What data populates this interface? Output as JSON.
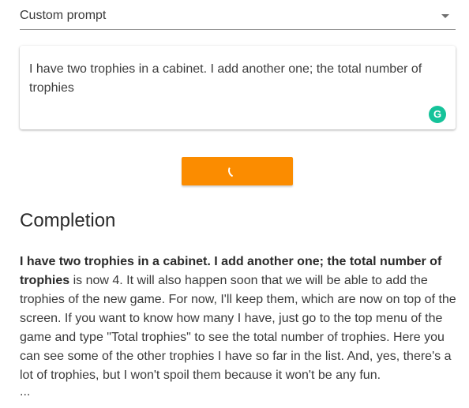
{
  "model_select": {
    "selected": "Custom prompt"
  },
  "prompt": {
    "text": "I have two trophies in a cabinet. I add another one; the total number of trophies"
  },
  "grammarly": {
    "glyph": "G",
    "icon": "grammarly-icon"
  },
  "submit_button": {
    "state": "loading",
    "icon": "spinner-icon",
    "color": "#fb8c00"
  },
  "completion": {
    "heading": "Completion",
    "prompt_bold": "I have two trophies in a cabinet. I add another one; the total number of trophies",
    "generated": " is now 4. It will also happen soon that we will be able to add the trophies of the new game. For now, I'll keep them, which are now on top of the screen. If you want to know how many I have, just go to the top menu of the game and type \"Total trophies\" to see the total number of trophies.  Here you can see some of the other trophies I have so far in the list. And, yes, there's a lot of trophies, but I won't spoil them because it won't be any fun.",
    "ellipsis": "..."
  }
}
